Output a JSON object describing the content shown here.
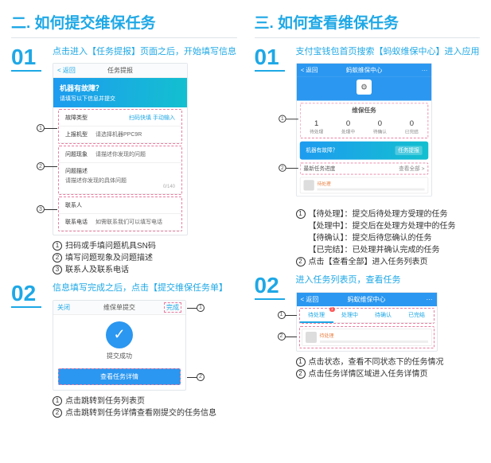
{
  "section2": {
    "title": "二. 如何提交维保任务",
    "step1": {
      "num": "01",
      "desc": "点击进入【任务提报】页面之后，开始填写信息",
      "mock": {
        "back": "< 返回",
        "title": "任务提报",
        "banner_title": "机器有故障？",
        "banner_sub": "请填写以下信息并提交",
        "row1_label": "故障类型",
        "row1_right": "扫码快填   手动输入",
        "row2_label": "上报机型",
        "row2_hint": "请选择机器PPC9R",
        "row3_label": "问题现象",
        "row3_hint": "请描述你发现的问题",
        "row4_label": "问题描述",
        "row4_hint": "请描述你发现的具体问题",
        "row4_count": "0/140",
        "row5_label": "联系人",
        "row6_label": "联系电话",
        "row6_hint": "如需联系我们可以填写电话"
      },
      "notes": [
        "扫码或手填问题机具SN码",
        "填写问题现象及问题描述",
        "联系人及联系电话"
      ]
    },
    "step2": {
      "num": "02",
      "desc": "信息填写完成之后，点击【提交维保任务单】",
      "mock": {
        "back": "关闭",
        "title": "维保单提交",
        "done": "完成",
        "success": "提交成功",
        "btn": "查看任务详情"
      },
      "notes": [
        "点击跳转到任务列表页",
        "点击跳转到任务详情查看刚提交的任务信息"
      ]
    }
  },
  "section3": {
    "title": "三. 如何查看维保任务",
    "step1": {
      "num": "01",
      "desc": "支付宝钱包首页搜索【蚂蚁维保中心】进入应用",
      "mock": {
        "back": "< 返回",
        "title": "蚂蚁维保中心",
        "more": "···",
        "task_heading": "维保任务",
        "stats": [
          {
            "label": "待处理",
            "value": "1"
          },
          {
            "label": "处理中",
            "value": "0"
          },
          {
            "label": "待确认",
            "value": "0"
          },
          {
            "label": "已完结",
            "value": "0"
          }
        ],
        "banner_title": "机器有故障？",
        "banner_btn": "任务提报",
        "recent_title": "最新任务进度",
        "recent_more": "查看全部 >",
        "item_status": "待处理"
      },
      "notes": [
        "【待处理】：提交后待处理方受理的任务",
        "【处理中】：提交后在处理方处理中的任务",
        "【待确认】：提交后待您确认的任务",
        "【已完结】：已处理并确认完成的任务",
        "点击【查看全部】进入任务列表页"
      ]
    },
    "step2": {
      "num": "02",
      "desc": "进入任务列表页，查看任务",
      "mock": {
        "back": "< 返回",
        "title": "蚂蚁维保中心",
        "more": "···",
        "tabs": [
          "待处理",
          "处理中",
          "待确认",
          "已完结"
        ],
        "badge": "1",
        "item_status": "待处理"
      },
      "notes": [
        "点击状态，查看不同状态下的任务情况",
        "点击任务详情区域进入任务详情页"
      ]
    }
  }
}
